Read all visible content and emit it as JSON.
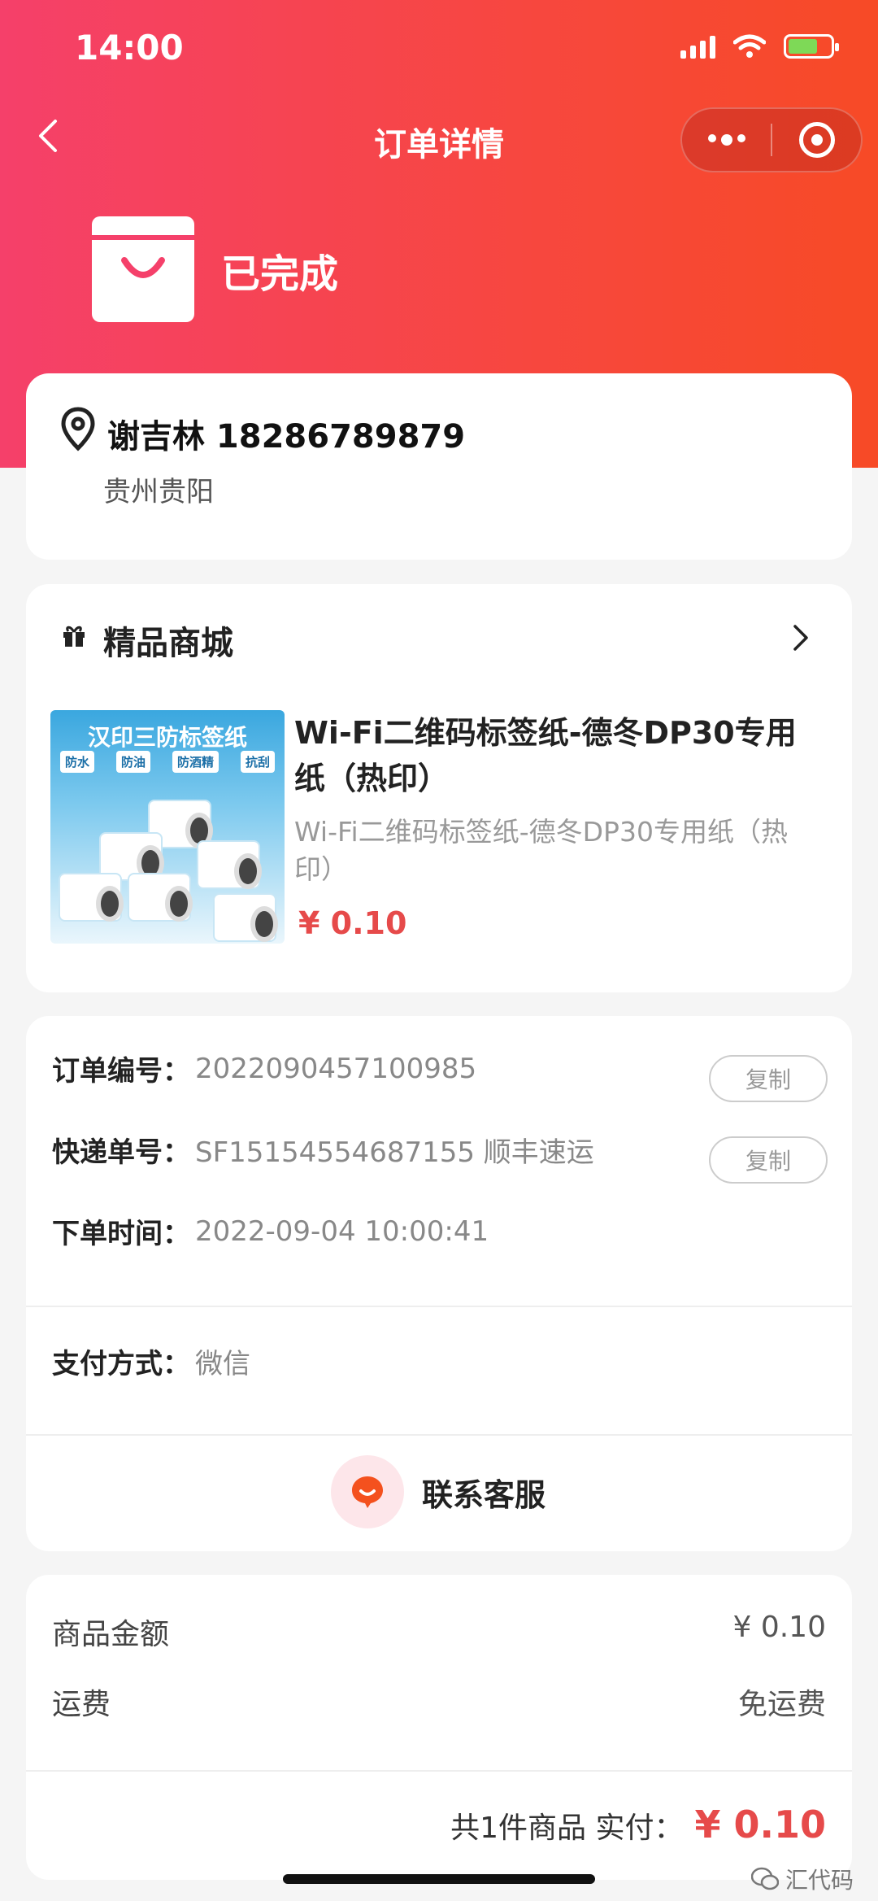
{
  "status_bar": {
    "time": "14:00"
  },
  "nav": {
    "title": "订单详情"
  },
  "order": {
    "status": "已完成"
  },
  "address": {
    "name_phone": "谢吉林 18286789879",
    "region": "贵州贵阳"
  },
  "shop": {
    "name": "精品商城",
    "product": {
      "title": "Wi-Fi二维码标签纸-德冬DP30专用纸（热印）",
      "subtitle": "Wi-Fi二维码标签纸-德冬DP30专用纸（热印）",
      "price": "¥ 0.10",
      "image": {
        "title": "汉印三防标签纸",
        "tags": [
          "防水",
          "防油",
          "防酒精",
          "抗刮"
        ]
      }
    }
  },
  "info": {
    "order_no_label": "订单编号：",
    "order_no": "2022090457100985",
    "tracking_label": "快递单号：",
    "tracking": "SF15154554687155 顺丰速运",
    "time_label": "下单时间：",
    "time": "2022-09-04 10:00:41",
    "copy": "复制",
    "pay_label": "支付方式：",
    "pay": "微信",
    "service": "联系客服"
  },
  "summary": {
    "goods_label": "商品金额",
    "goods_value": "¥ 0.10",
    "shipping_label": "运费",
    "shipping_value": "免运费",
    "total_label": "共1件商品  实付：",
    "total_value": "¥ 0.10"
  },
  "watermark": "汇代码",
  "colors": {
    "accent": "#f7473f",
    "price": "#e64a4a",
    "battery": "#7ed957"
  }
}
